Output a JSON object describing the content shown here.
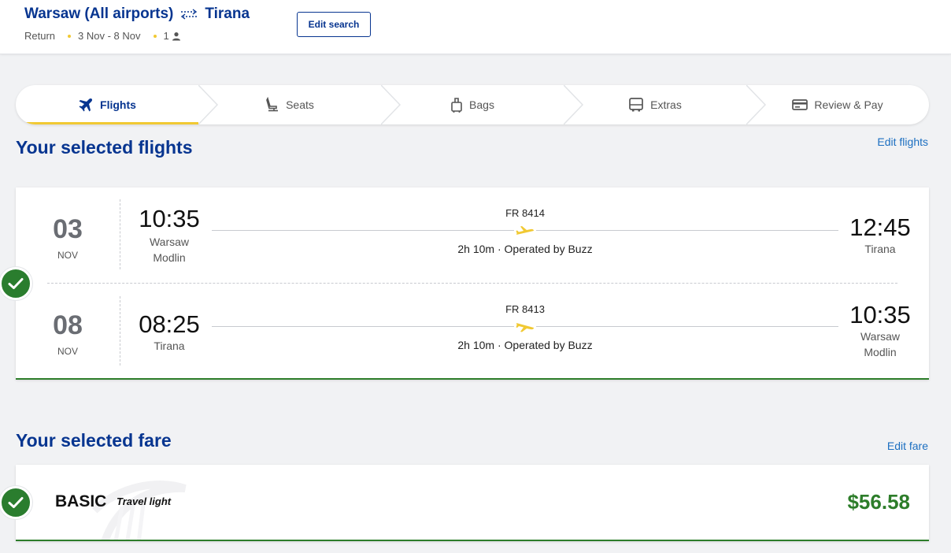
{
  "header": {
    "origin": "Warsaw (All airports)",
    "destination": "Tirana",
    "trip_type": "Return",
    "dates": "3 Nov - 8 Nov",
    "passengers": "1",
    "edit_search_label": "Edit search"
  },
  "stepper": {
    "steps": [
      {
        "label": "Flights",
        "icon": "plane-icon",
        "active": true
      },
      {
        "label": "Seats",
        "icon": "seat-icon",
        "active": false
      },
      {
        "label": "Bags",
        "icon": "bag-icon",
        "active": false
      },
      {
        "label": "Extras",
        "icon": "bus-icon",
        "active": false
      },
      {
        "label": "Review & Pay",
        "icon": "card-icon",
        "active": false
      }
    ]
  },
  "flights_section": {
    "title": "Your selected flights",
    "edit_label": "Edit flights",
    "legs": [
      {
        "day": "03",
        "month": "NOV",
        "dep_time": "10:35",
        "dep_place_1": "Warsaw",
        "dep_place_2": "Modlin",
        "flight_no": "FR 8414",
        "duration": "2h 10m · Operated by Buzz",
        "arr_time": "12:45",
        "arr_place_1": "Tirana",
        "arr_place_2": ""
      },
      {
        "day": "08",
        "month": "NOV",
        "dep_time": "08:25",
        "dep_place_1": "Tirana",
        "dep_place_2": "",
        "flight_no": "FR 8413",
        "duration": "2h 10m · Operated by Buzz",
        "arr_time": "10:35",
        "arr_place_1": "Warsaw",
        "arr_place_2": "Modlin"
      }
    ]
  },
  "fare_section": {
    "title": "Your selected fare",
    "edit_label": "Edit fare",
    "fare_name": "BASIC",
    "fare_tagline": "Travel light",
    "price": "$56.58"
  },
  "colors": {
    "brand_blue": "#073590",
    "accent_yellow": "#f1c933",
    "success_green": "#2d7d2a",
    "link_blue": "#1c6fc1"
  }
}
